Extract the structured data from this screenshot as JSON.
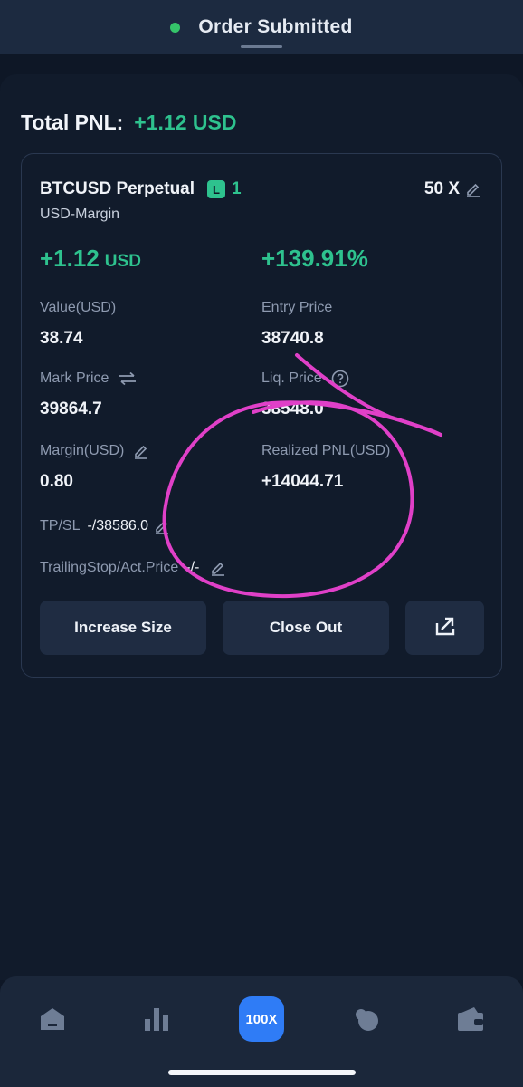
{
  "toast": {
    "text": "Order Submitted"
  },
  "total_pnl": {
    "label": "Total PNL:",
    "value": "+1.12 USD"
  },
  "position": {
    "symbol": "BTCUSD Perpetual",
    "side_badge": "L",
    "side_count": "1",
    "margin_type": "USD-Margin",
    "leverage": "50 X",
    "pnl_amount": "+1.12",
    "pnl_unit": "USD",
    "pnl_percent": "+139.91%",
    "value_label": "Value(USD)",
    "value": "38.74",
    "entry_label": "Entry Price",
    "entry_price": "38740.8",
    "mark_label": "Mark Price",
    "mark_price": "39864.7",
    "liq_label": "Liq. Price",
    "liq_price": "38548.0",
    "margin_label": "Margin(USD)",
    "margin": "0.80",
    "realized_label": "Realized PNL(USD)",
    "realized_pnl": "+14044.71",
    "tpsl_label": "TP/SL",
    "tpsl_value": "-/38586.0",
    "trailing_label": "TrailingStop/Act.Price",
    "trailing_value": "-/-"
  },
  "actions": {
    "increase": "Increase Size",
    "close": "Close Out"
  },
  "nav": {
    "items": [
      "home-icon",
      "markets-icon",
      "100X",
      "discover-icon",
      "wallet-icon"
    ]
  },
  "colors": {
    "accent_green": "#2ec28e",
    "accent_blue": "#2f7cf6",
    "annotation": "#e040c8",
    "background": "#0e1726"
  }
}
